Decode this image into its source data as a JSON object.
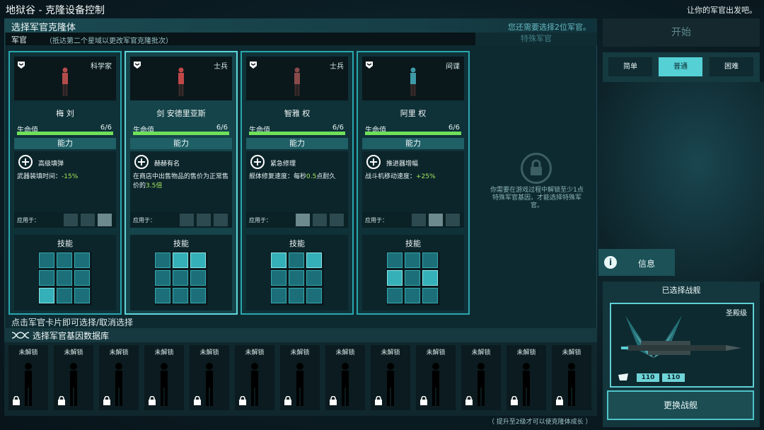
{
  "header": {
    "title": "地狱谷 - 克隆设备控制",
    "hint": "让你的军官出发吧。"
  },
  "main": {
    "title": "选择军官克隆体",
    "need_more": "您还需要选择2位军官。",
    "sub_label": "军官",
    "sub_note": "（抵达第二个星域以更改军官克隆批次）",
    "special_tab": "特殊军官",
    "click_hint": "点击军官卡片即可选择/取消选择",
    "hp_label": "生命值",
    "ability_title": "能力",
    "skills_title": "技能",
    "applies_label": "应用于："
  },
  "officers": [
    {
      "name": "梅 刘",
      "role": "科学家",
      "hp": "6/6",
      "hp_fraction": 1.0,
      "selected": false,
      "ability_name": "高级填弹",
      "ability_desc_pre": "武器装填时间：",
      "ability_desc_hl": "-15%",
      "ability_desc_post": "",
      "skin": "#b44c4c",
      "ships_on": [
        false,
        false,
        true
      ],
      "skills_on": [
        false,
        false,
        false,
        false,
        false,
        false,
        true,
        false,
        false
      ]
    },
    {
      "name": "剑 安德里亚斯",
      "role": "士兵",
      "hp": "6/6",
      "hp_fraction": 1.0,
      "selected": true,
      "ability_name": "赫赫有名",
      "ability_desc_pre": "在商店中出售物品的售价为正常售价的",
      "ability_desc_hl": "3.5倍",
      "ability_desc_post": "",
      "skin": "#c04848",
      "ships_on": [
        false,
        false,
        false
      ],
      "skills_on": [
        false,
        true,
        true,
        false,
        false,
        false,
        false,
        false,
        false
      ]
    },
    {
      "name": "智雅 权",
      "role": "士兵",
      "hp": "6/6",
      "hp_fraction": 1.0,
      "selected": false,
      "ability_name": "紧急修理",
      "ability_desc_pre": "舰体修复速度：每秒",
      "ability_desc_hl": "0.5",
      "ability_desc_post": "点耐久",
      "skin": "#8a4a4a",
      "ships_on": [
        true,
        false,
        false
      ],
      "skills_on": [
        true,
        false,
        true,
        false,
        false,
        false,
        false,
        false,
        false
      ]
    },
    {
      "name": "阿里 权",
      "role": "间谍",
      "hp": "6/6",
      "hp_fraction": 1.0,
      "selected": false,
      "ability_name": "推进器增幅",
      "ability_desc_pre": "战斗机移动速度：",
      "ability_desc_hl": "+25%",
      "ability_desc_post": "",
      "skin": "#3f9aa8",
      "ships_on": [
        false,
        true,
        false
      ],
      "skills_on": [
        false,
        false,
        false,
        true,
        false,
        true,
        false,
        false,
        false
      ]
    }
  ],
  "special": {
    "locked_text": "你需要在游戏过程中解锁至少1点特殊军官基因，才能选择特殊军官。"
  },
  "gene_bank": {
    "title": "选择军官基因数据库",
    "slots": [
      "未解锁",
      "未解锁",
      "未解锁",
      "未解锁",
      "未解锁",
      "未解锁",
      "未解锁",
      "未解锁",
      "未解锁",
      "未解锁",
      "未解锁",
      "未解锁",
      "未解锁"
    ],
    "footnote": "（ 提升至2级才可以使克隆体成长 ）"
  },
  "right": {
    "start_label": "开始",
    "difficulties": [
      {
        "label": "简单",
        "active": false
      },
      {
        "label": "普通",
        "active": true
      },
      {
        "label": "困难",
        "active": false
      }
    ],
    "info_label": "信息",
    "ship_title": "已选择战舰",
    "ship_class": "圣殿级",
    "stat_a": "110",
    "stat_b": "110",
    "change_label": "更换战舰"
  },
  "colors": {
    "accent": "#5fd6db",
    "hp_green": "#6ee05a",
    "highlight": "#a3e65a",
    "background": "#0c1d24"
  }
}
